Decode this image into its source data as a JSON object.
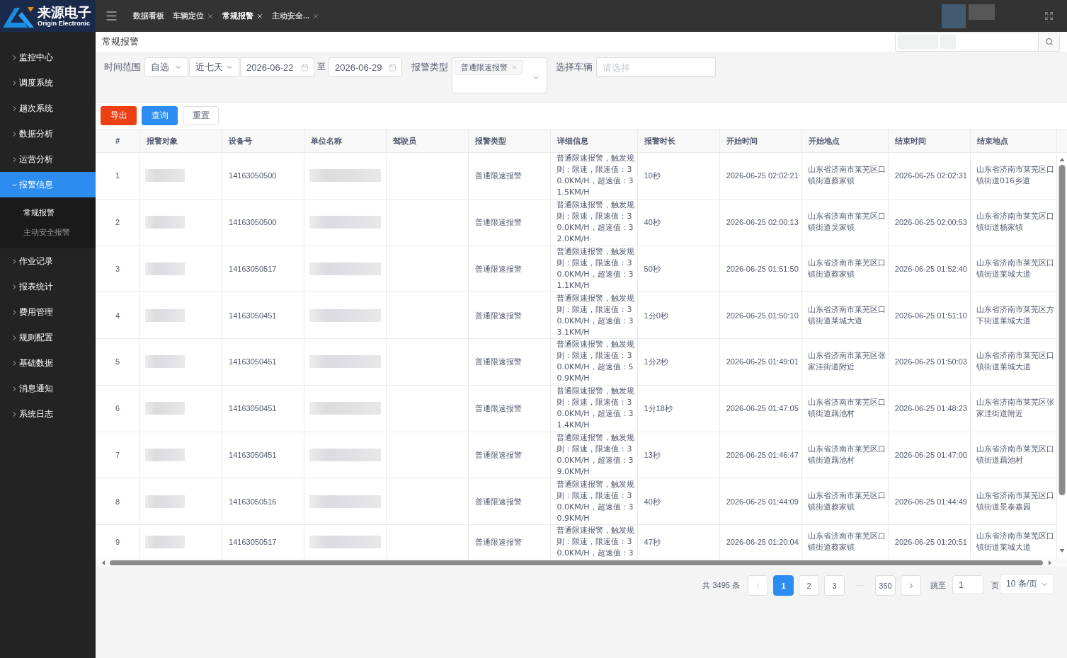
{
  "logo": {
    "title": "来源电子",
    "subtitle": "Origin Electronic"
  },
  "tabs": [
    {
      "label": "数据看板",
      "closable": false,
      "selected": false
    },
    {
      "label": "车辆定位",
      "closable": true,
      "selected": false
    },
    {
      "label": "常规报警",
      "closable": true,
      "selected": true
    },
    {
      "label": "主动安全...",
      "closable": true,
      "selected": false
    }
  ],
  "sidebar": {
    "items": [
      {
        "label": "监控中心",
        "expanded": false,
        "selected": false
      },
      {
        "label": "调度系统",
        "expanded": false,
        "selected": false
      },
      {
        "label": "趟次系统",
        "expanded": false,
        "selected": false
      },
      {
        "label": "数据分析",
        "expanded": false,
        "selected": false
      },
      {
        "label": "运营分析",
        "expanded": false,
        "selected": false
      },
      {
        "label": "报警信息",
        "expanded": true,
        "selected": true,
        "children": [
          {
            "label": "常规报警",
            "selected": true
          },
          {
            "label": "主动安全报警",
            "selected": false
          }
        ]
      },
      {
        "label": "作业记录",
        "expanded": false,
        "selected": false
      },
      {
        "label": "报表统计",
        "expanded": false,
        "selected": false
      },
      {
        "label": "费用管理",
        "expanded": false,
        "selected": false
      },
      {
        "label": "规则配置",
        "expanded": false,
        "selected": false
      },
      {
        "label": "基础数据",
        "expanded": false,
        "selected": false
      },
      {
        "label": "消息通知",
        "expanded": false,
        "selected": false
      },
      {
        "label": "系统日志",
        "expanded": false,
        "selected": false
      }
    ]
  },
  "page_title": "常规报警",
  "filters": {
    "time_range": {
      "label": "时间范围",
      "mode": "自选",
      "preset": "近七天",
      "start_date": "2026-06-22",
      "separator": "至",
      "end_date": "2026-06-29"
    },
    "alarm_type": {
      "label": "报警类型",
      "tags": [
        "普通限速报警"
      ]
    },
    "vehicle": {
      "label": "选择车辆",
      "placeholder": "请选择"
    }
  },
  "buttons": [
    {
      "label": "导出",
      "kind": "danger"
    },
    {
      "label": "查询",
      "kind": "primary"
    },
    {
      "label": "重置",
      "kind": "default"
    }
  ],
  "table": {
    "columns": [
      "#",
      "报警对象",
      "设备号",
      "单位名称",
      "驾驶员",
      "报警类型",
      "详细信息",
      "报警时长",
      "开始时间",
      "开始地点",
      "结束时间",
      "结束地点"
    ],
    "rows": [
      {
        "number": "1",
        "alarm_object": {
          "kind": "redacted"
        },
        "device_no": "14163050500",
        "unit_name": {
          "kind": "redacted"
        },
        "alarm_type": "普通限速报警",
        "details": "普通限速报警，触发规则：限速，限速值：30.0KM/H，超速值：31.5KM/H",
        "duration": "10秒",
        "start_time": "2026-06-25 02:02:21",
        "start_location": "山东省济南市莱芜区口镇街道蔡家镇",
        "end_time": "2026-06-25 02:02:31",
        "end_location": "山东省济南市莱芜区口镇街道016乡道"
      },
      {
        "number": "2",
        "alarm_object": {
          "kind": "redacted"
        },
        "device_no": "14163050500",
        "unit_name": {
          "kind": "redacted"
        },
        "alarm_type": "普通限速报警",
        "details": "普通限速报警，触发规则：限速，限速值：30.0KM/H，超速值：32.0KM/H",
        "duration": "40秒",
        "start_time": "2026-06-25 02:00:13",
        "start_location": "山东省济南市莱芜区口镇街道吴家镇",
        "end_time": "2026-06-25 02:00:53",
        "end_location": "山东省济南市莱芜区口镇街道杨家镇"
      },
      {
        "number": "3",
        "alarm_object": {
          "kind": "redacted"
        },
        "device_no": "14163050517",
        "unit_name": {
          "kind": "redacted"
        },
        "alarm_type": "普通限速报警",
        "details": "普通限速报警，触发规则：限速，限速值：30.0KM/H，超速值：31.1KM/H",
        "duration": "50秒",
        "start_time": "2026-06-25 01:51:50",
        "start_location": "山东省济南市莱芜区口镇街道蔡家镇",
        "end_time": "2026-06-25 01:52:40",
        "end_location": "山东省济南市莱芜区口镇街道莱城大道"
      },
      {
        "number": "4",
        "alarm_object": {
          "kind": "redacted"
        },
        "device_no": "14163050451",
        "unit_name": {
          "kind": "redacted"
        },
        "alarm_type": "普通限速报警",
        "details": "普通限速报警，触发规则：限速，限速值：30.0KM/H，超速值：33.1KM/H",
        "duration": "1分0秒",
        "start_time": "2026-06-25 01:50:10",
        "start_location": "山东省济南市莱芜区口镇街道莱城大道",
        "end_time": "2026-06-25 01:51:10",
        "end_location": "山东省济南市莱芜区方下街道莱城大道"
      },
      {
        "number": "5",
        "alarm_object": {
          "kind": "redacted"
        },
        "device_no": "14163050451",
        "unit_name": {
          "kind": "redacted"
        },
        "alarm_type": "普通限速报警",
        "details": "普通限速报警，触发规则：限速，限速值：30.0KM/H，超速值：50.9KM/H",
        "duration": "1分2秒",
        "start_time": "2026-06-25 01:49:01",
        "start_location": "山东省济南市莱芜区张家洼街道附近",
        "end_time": "2026-06-25 01:50:03",
        "end_location": "山东省济南市莱芜区口镇街道莱城大道"
      },
      {
        "number": "6",
        "alarm_object": {
          "kind": "redacted"
        },
        "device_no": "14163050451",
        "unit_name": {
          "kind": "redacted"
        },
        "alarm_type": "普通限速报警",
        "details": "普通限速报警，触发规则：限速，限速值：30.0KM/H，超速值：31.4KM/H",
        "duration": "1分18秒",
        "start_time": "2026-06-25 01:47:05",
        "start_location": "山东省济南市莱芜区口镇街道藕池村",
        "end_time": "2026-06-25 01:48:23",
        "end_location": "山东省济南市莱芜区张家洼街道附近"
      },
      {
        "number": "7",
        "alarm_object": {
          "kind": "redacted"
        },
        "device_no": "14163050451",
        "unit_name": {
          "kind": "redacted"
        },
        "alarm_type": "普通限速报警",
        "details": "普通限速报警，触发规则：限速，限速值：30.0KM/H，超速值：39.0KM/H",
        "duration": "13秒",
        "start_time": "2026-06-25 01:46:47",
        "start_location": "山东省济南市莱芜区口镇街道藕池村",
        "end_time": "2026-06-25 01:47:00",
        "end_location": "山东省济南市莱芜区口镇街道藕池村"
      },
      {
        "number": "8",
        "alarm_object": {
          "kind": "redacted"
        },
        "device_no": "14163050516",
        "unit_name": {
          "kind": "redacted"
        },
        "alarm_type": "普通限速报警",
        "details": "普通限速报警，触发规则：限速，限速值：30.0KM/H，超速值：30.9KM/H",
        "duration": "40秒",
        "start_time": "2026-06-25 01:44:09",
        "start_location": "山东省济南市莱芜区口镇街道蔡家镇",
        "end_time": "2026-06-25 01:44:49",
        "end_location": "山东省济南市莱芜区口镇街道景泰嘉园"
      },
      {
        "number": "9",
        "alarm_object": {
          "kind": "redacted"
        },
        "device_no": "14163050517",
        "unit_name": {
          "kind": "redacted"
        },
        "alarm_type": "普通限速报警",
        "details": "普通限速报警，触发规则：限速，限速值：30.0KM/H，超速值：3",
        "duration": "47秒",
        "start_time": "2026-06-25 01:20:04",
        "start_location": "山东省济南市莱芜区口镇街道蔡家镇",
        "end_time": "2026-06-25 01:20:51",
        "end_location": "山东省济南市莱芜区口镇街道莱城大道"
      }
    ]
  },
  "pagination": {
    "total": "共 3495 条",
    "pages": [
      {
        "kind": "page",
        "label": "1",
        "selected": true
      },
      {
        "kind": "page",
        "label": "2",
        "selected": false
      },
      {
        "kind": "page",
        "label": "3",
        "selected": false
      },
      {
        "kind": "ellipsis",
        "label": "···"
      },
      {
        "kind": "page",
        "label": "350",
        "selected": false
      }
    ],
    "jump_label": "跳至",
    "jump_value": "1",
    "jump_suffix": "页",
    "page_size": "10 条/页"
  }
}
